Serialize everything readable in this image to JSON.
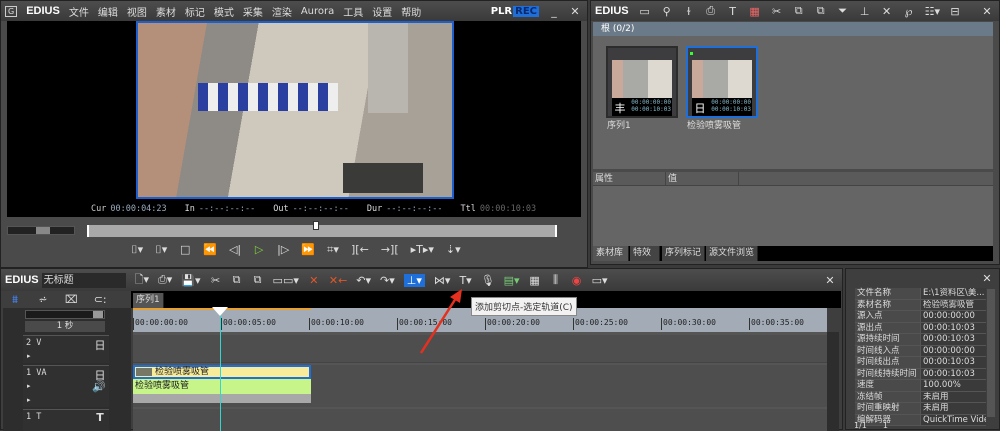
{
  "player": {
    "logo": "EDIUS",
    "menu": [
      "文件",
      "编辑",
      "视图",
      "素材",
      "标记",
      "模式",
      "采集",
      "渲染",
      "Aurora",
      "工具",
      "设置",
      "帮助"
    ],
    "plr": "PLR",
    "rec": "REC",
    "cur_label": "Cur",
    "cur": "00:00:04:23",
    "in_label": "In",
    "in": "--:--:--:--",
    "out_label": "Out",
    "out": "--:--:--:--",
    "dur_label": "Dur",
    "dur": "--:--:--:--",
    "ttl_label": "Ttl",
    "ttl": "00:00:10:03"
  },
  "bin": {
    "logo": "EDIUS",
    "folder": "根 (0/2)",
    "clips": [
      {
        "name": "序列1",
        "in": "00:00:00:00",
        "out": "00:00:10:03",
        "icon": "sequence-icon"
      },
      {
        "name": "检验喷雾吸管",
        "in": "00:00:00:00",
        "out": "00:00:10:03",
        "icon": "video-icon"
      }
    ],
    "prop_header": "属性",
    "value_header": "值",
    "tabs": [
      "素材库",
      "特效",
      "序列标记",
      "源文件浏览"
    ]
  },
  "timeline": {
    "logo": "EDIUS",
    "project": "无标题",
    "sequence_tab": "序列1",
    "scale": "1 秒",
    "tooltip": "添加剪切点-选定轨道(C)",
    "ruler": [
      "00:00:00:00",
      "00:00:05:00",
      "00:00:10:00",
      "00:00:15:00",
      "00:00:20:00",
      "00:00:25:00",
      "00:00:30:00",
      "00:00:35:00"
    ],
    "tracks": [
      {
        "name": "2 V"
      },
      {
        "name": "1 VA"
      },
      {
        "name": "1 T"
      }
    ],
    "clip_video": "检验喷雾吸管",
    "clip_audio": "检验喷雾吸管",
    "playhead_seconds": 4.96,
    "clip_duration_seconds": 10.1
  },
  "info": {
    "rows": [
      [
        "文件名称",
        "E:\\1资料区\\美..."
      ],
      [
        "素材名称",
        "检验喷雾吸管"
      ],
      [
        "源入点",
        "00:00:00:00"
      ],
      [
        "源出点",
        "00:00:10:03"
      ],
      [
        "源持续时间",
        "00:00:10:03"
      ],
      [
        "时间线入点",
        "00:00:00:00"
      ],
      [
        "时间线出点",
        "00:00:10:03"
      ],
      [
        "时间线持续时间",
        "00:00:10:03"
      ],
      [
        "速度",
        "100.00%"
      ],
      [
        "冻结帧",
        "未启用"
      ],
      [
        "时间重映射",
        "未启用"
      ],
      [
        "编解码器",
        "QuickTime Vide..."
      ]
    ],
    "page": "1/1",
    "count": "1"
  },
  "colors": {
    "accent": "#1e6fd9",
    "play": "#7fd23a",
    "clip_video": "#f8eb9a",
    "clip_audio": "#c7f58a",
    "playhead": "#32d6d0",
    "cut": "#e0572a"
  }
}
